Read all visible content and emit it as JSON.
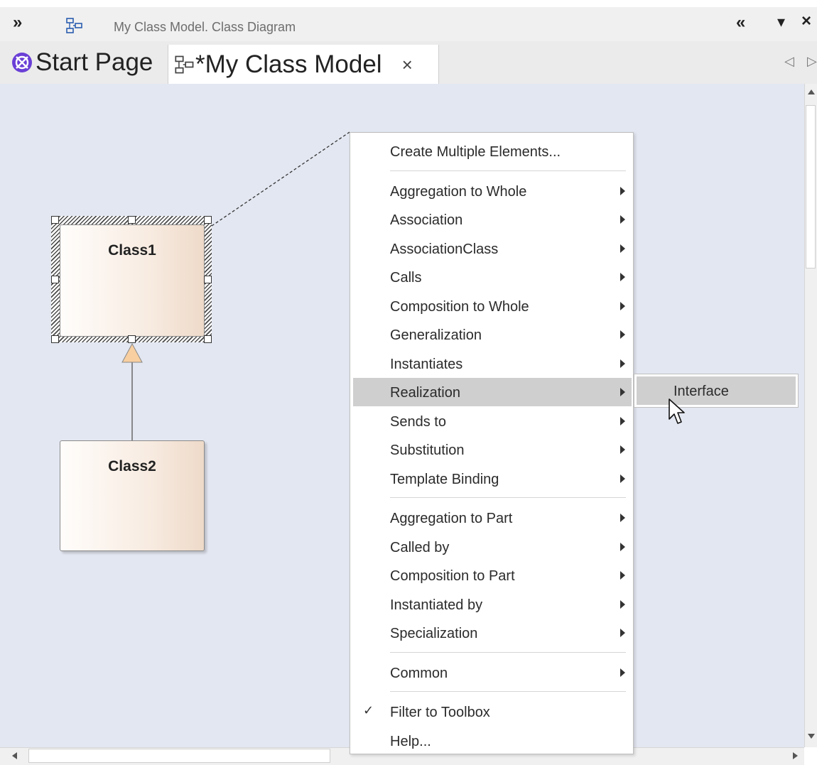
{
  "window": {
    "title": "My Class Model.  Class Diagram",
    "expand_glyph": "»",
    "collapse_glyph": "«",
    "dropdown_glyph": "▾",
    "close_glyph": "×"
  },
  "tabs": [
    {
      "label": "Start Page",
      "icon": "start-page-icon"
    },
    {
      "label": "*My Class Model",
      "icon": "class-diagram-icon",
      "close": "×",
      "active": true
    }
  ],
  "tab_nav": {
    "prev": "◁",
    "next": "▷"
  },
  "diagram": {
    "class1": "Class1",
    "class2": "Class2"
  },
  "menu": {
    "items": [
      {
        "label": "Create Multiple Elements...",
        "submenu": false
      },
      {
        "sep": true
      },
      {
        "label": "Aggregation to Whole",
        "submenu": true
      },
      {
        "label": "Association",
        "submenu": true
      },
      {
        "label": "AssociationClass",
        "submenu": true
      },
      {
        "label": "Calls",
        "submenu": true
      },
      {
        "label": "Composition to Whole",
        "submenu": true
      },
      {
        "label": "Generalization",
        "submenu": true
      },
      {
        "label": "Instantiates",
        "submenu": true
      },
      {
        "label": "Realization",
        "submenu": true,
        "highlighted": true
      },
      {
        "label": "Sends to",
        "submenu": true
      },
      {
        "label": "Substitution",
        "submenu": true
      },
      {
        "label": "Template Binding",
        "submenu": true
      },
      {
        "sep": true
      },
      {
        "label": "Aggregation to Part",
        "submenu": true
      },
      {
        "label": "Called by",
        "submenu": true
      },
      {
        "label": "Composition to Part",
        "submenu": true
      },
      {
        "label": "Instantiated by",
        "submenu": true
      },
      {
        "label": "Specialization",
        "submenu": true
      },
      {
        "sep": true
      },
      {
        "label": "Common",
        "submenu": true
      },
      {
        "sep": true
      },
      {
        "label": "Filter to Toolbox",
        "submenu": false,
        "checked": true
      },
      {
        "label": "Help...",
        "submenu": false
      }
    ],
    "check_glyph": "✓"
  },
  "submenu": {
    "items": [
      {
        "label": "Interface",
        "highlighted": true
      }
    ]
  },
  "colors": {
    "canvas": "#e3e7f1",
    "highlight": "#cfcfcf",
    "start_page_icon": "#6a3fd6",
    "generalization_arrow": "#f8cfa0"
  }
}
